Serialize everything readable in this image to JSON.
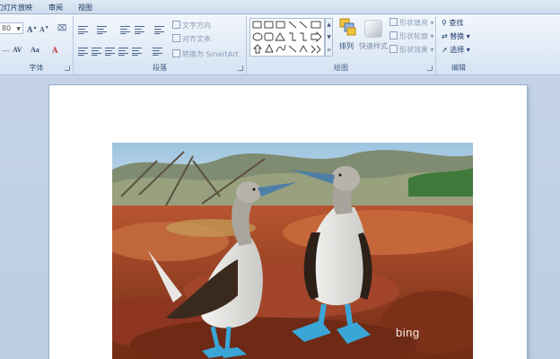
{
  "tabs": {
    "slideshow": "幻灯片放映",
    "review": "审阅",
    "view": "视图"
  },
  "ribbon": {
    "font_group": {
      "label": "字体",
      "font_size": "80"
    },
    "paragraph_group": {
      "label": "段落",
      "text_direction": "文字方向",
      "align_text": "对齐文本",
      "convert_smartart": "转换为 SmartArt"
    },
    "drawing_group": {
      "label": "绘图",
      "arrange": "排列",
      "quick_styles": "快速样式",
      "shape_fill": "形状填充",
      "shape_outline": "形状轮廓",
      "shape_effects": "形状效果"
    },
    "editing_group": {
      "label": "编辑",
      "find": "查找",
      "replace": "替换",
      "select": "选择"
    }
  },
  "slide": {
    "watermark": "bing"
  },
  "colors": {
    "ribbon_bg": "#e3ecf7",
    "workspace_bg": "#c4d3e8",
    "sky": "#8fb8d6",
    "rock": "#b4492a",
    "bird_feet": "#3aa6d8"
  }
}
